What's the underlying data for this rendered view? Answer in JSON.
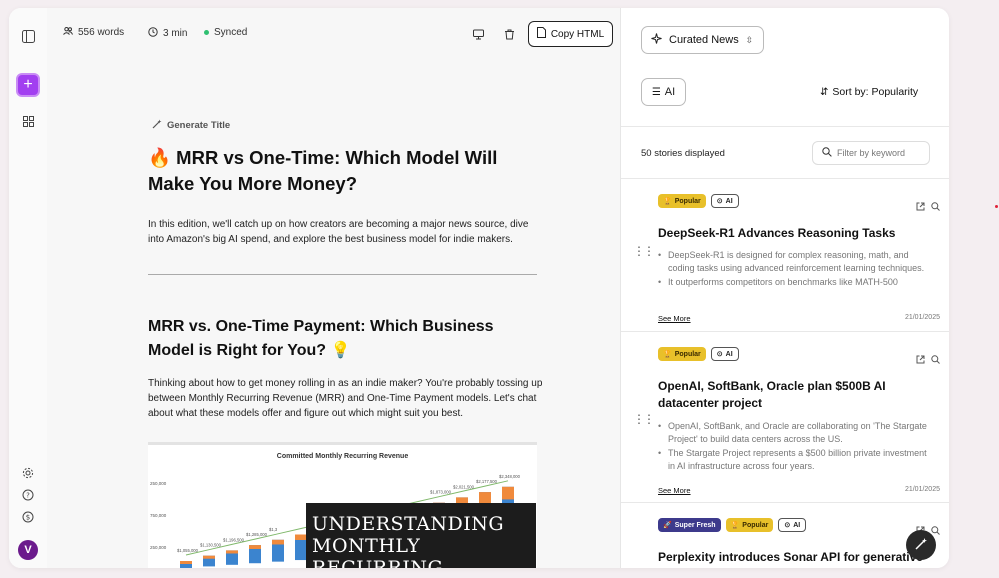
{
  "topbar": {
    "words": "556 words",
    "read_time": "3 min",
    "sync_status": "Synced",
    "copy_label": "Copy HTML"
  },
  "editor": {
    "generate_title": "Generate Title",
    "title": "🔥 MRR vs One-Time: Which Model Will Make You More Money?",
    "intro": "In this edition, we'll catch up on how creators are becoming a major news source, dive into Amazon's big AI spend, and explore the best business model for indie makers.",
    "section_title": "MRR vs. One-Time Payment: Which Business Model is Right for You? 💡",
    "section_body": "Thinking about how to get money rolling in as an indie maker? You're probably tossing up between Monthly Recurring Revenue (MRR) and One-Time Payment models. Let's chat about what these models offer and figure out which might suit you best.",
    "overlay_text": "UNDERSTANDING MONTHLY RECURRING"
  },
  "chart_data": {
    "type": "bar",
    "title": "Committed Monthly Recurring Revenue",
    "y_tick_labels": [
      "250,000",
      "750,000",
      "250,000"
    ],
    "point_labels": [
      "$1,055,000",
      "$1,130,500",
      "$1,196,500",
      "$1,285,000",
      "$1,3",
      "$1,873,000",
      "$2,021,500",
      "$2,177,500",
      "$2,348,000"
    ]
  },
  "side": {
    "feed_select": "Curated News",
    "filter_chip": "AI",
    "sort_label": "Sort by: Popularity",
    "count": "50 stories displayed",
    "filter_placeholder": "Filter by keyword",
    "cards": [
      {
        "badges": [
          "Popular",
          "AI"
        ],
        "title": "DeepSeek-R1 Advances Reasoning Tasks",
        "bullets": [
          "DeepSeek-R1 is designed for complex reasoning, math, and coding tasks using advanced reinforcement learning techniques.",
          "It outperforms competitors on benchmarks like MATH-500"
        ],
        "see_more": "See More",
        "date": "21/01/2025"
      },
      {
        "badges": [
          "Popular",
          "AI"
        ],
        "title": "OpenAI, SoftBank, Oracle plan $500B AI datacenter project",
        "bullets": [
          "OpenAI, SoftBank, and Oracle are collaborating on 'The Stargate Project' to build data centers across the US.",
          "The Stargate Project represents a $500 billion private investment in AI infrastructure across four years."
        ],
        "see_more": "See More",
        "date": "21/01/2025"
      },
      {
        "badges": [
          "Super Fresh",
          "Popular",
          "AI"
        ],
        "title": "Perplexity introduces Sonar API for generative search"
      }
    ]
  },
  "user": {
    "avatar_letter": "V"
  },
  "colors": {
    "accent": "#a23ff0",
    "popular": "#e8c02a",
    "fresh": "#3d3a8c",
    "synced": "#2fbf71"
  }
}
